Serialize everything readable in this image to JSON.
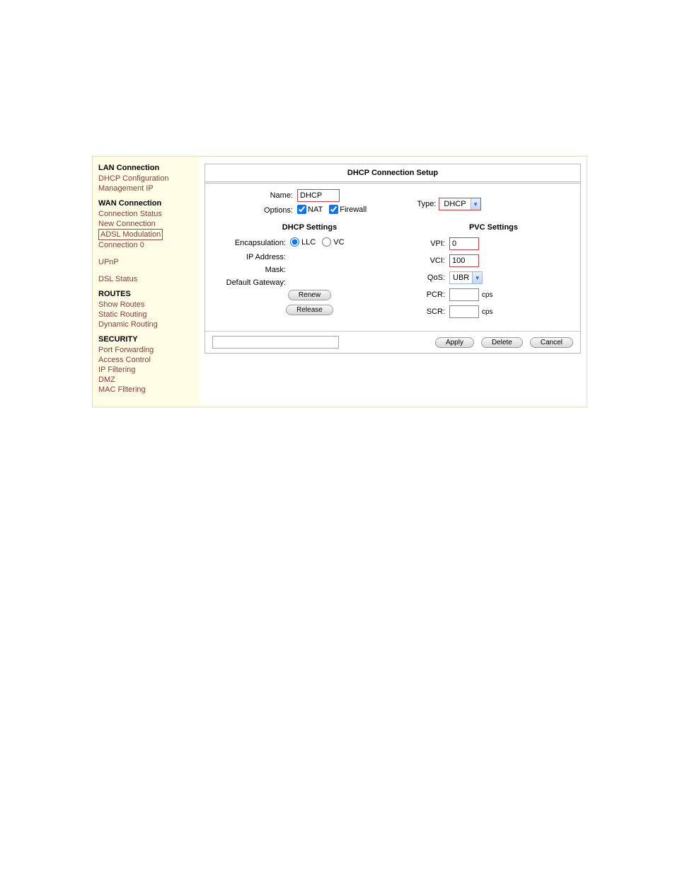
{
  "sidebar": {
    "groups": [
      {
        "heading": "LAN Connection",
        "links": [
          {
            "label": "DHCP Configuration",
            "name": "nav-dhcp-configuration"
          },
          {
            "label": "Management IP",
            "name": "nav-management-ip"
          }
        ]
      },
      {
        "heading": "WAN Connection",
        "links": [
          {
            "label": "Connection Status",
            "name": "nav-connection-status"
          },
          {
            "label": "New Connection",
            "name": "nav-new-connection"
          },
          {
            "label": "ADSL Modulation",
            "name": "nav-adsl-modulation",
            "boxed": true
          },
          {
            "label": "Connection 0",
            "name": "nav-connection-0"
          }
        ]
      },
      {
        "heading": "",
        "links": [
          {
            "label": "UPnP",
            "name": "nav-upnp"
          }
        ]
      },
      {
        "heading": "",
        "links": [
          {
            "label": "DSL Status",
            "name": "nav-dsl-status"
          }
        ]
      },
      {
        "heading": "ROUTES",
        "links": [
          {
            "label": "Show Routes",
            "name": "nav-show-routes"
          },
          {
            "label": "Static Routing",
            "name": "nav-static-routing"
          },
          {
            "label": "Dynamic Routing",
            "name": "nav-dynamic-routing"
          }
        ]
      },
      {
        "heading": "SECURITY",
        "links": [
          {
            "label": "Port Forwarding",
            "name": "nav-port-forwarding"
          },
          {
            "label": "Access Control",
            "name": "nav-access-control"
          },
          {
            "label": "IP Filtering",
            "name": "nav-ip-filtering"
          },
          {
            "label": "DMZ",
            "name": "nav-dmz"
          },
          {
            "label": "MAC Filtering",
            "name": "nav-mac-filtering"
          }
        ]
      }
    ]
  },
  "panel": {
    "title": "DHCP Connection Setup",
    "name_label": "Name:",
    "name_value": "DHCP",
    "options_label": "Options:",
    "opt_nat": "NAT",
    "opt_firewall": "Firewall",
    "type_label": "Type:",
    "type_value": "DHCP",
    "dhcp_section": "DHCP Settings",
    "pvc_section": "PVC Settings",
    "encap_label": "Encapsulation:",
    "encap_llc": "LLC",
    "encap_vc": "VC",
    "ip_label": "IP Address:",
    "mask_label": "Mask:",
    "gw_label": "Default Gateway:",
    "renew_btn": "Renew",
    "release_btn": "Release",
    "vpi_label": "VPI:",
    "vpi_value": "0",
    "vci_label": "VCI:",
    "vci_value": "100",
    "qos_label": "QoS:",
    "qos_value": "UBR",
    "pcr_label": "PCR:",
    "pcr_value": "",
    "scr_label": "SCR:",
    "scr_value": "",
    "unit_cps": "cps",
    "apply_btn": "Apply",
    "delete_btn": "Delete",
    "cancel_btn": "Cancel"
  }
}
